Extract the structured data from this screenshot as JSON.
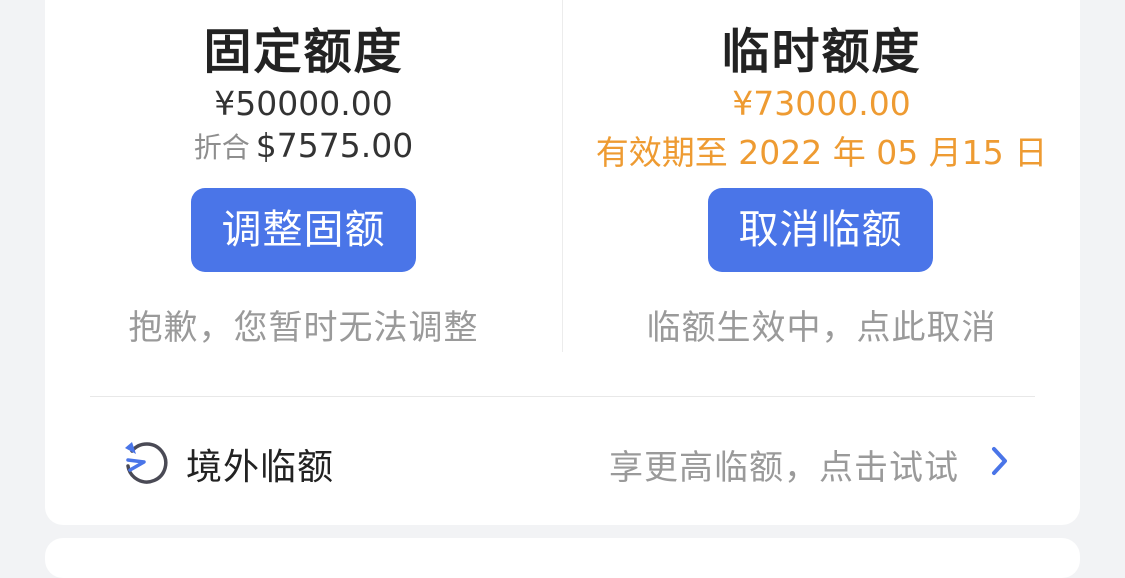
{
  "fixed_limit": {
    "title": "固定额度",
    "amount": "¥50000.00",
    "converted_prefix": "折合",
    "converted_amount": "$7575.00",
    "button_label": "调整固额",
    "hint": "抱歉，您暂时无法调整"
  },
  "temp_limit": {
    "title": "临时额度",
    "amount": "¥73000.00",
    "valid_until": "有效期至 2022 年 05 月15 日",
    "button_label": "取消临额",
    "hint": "临额生效中，点此取消"
  },
  "overseas": {
    "label": "境外临额",
    "promo": "享更高临额，点击试试",
    "icon": "clock-plane-icon"
  },
  "colors": {
    "accent_blue": "#4a75e8",
    "orange": "#ee9b32"
  }
}
